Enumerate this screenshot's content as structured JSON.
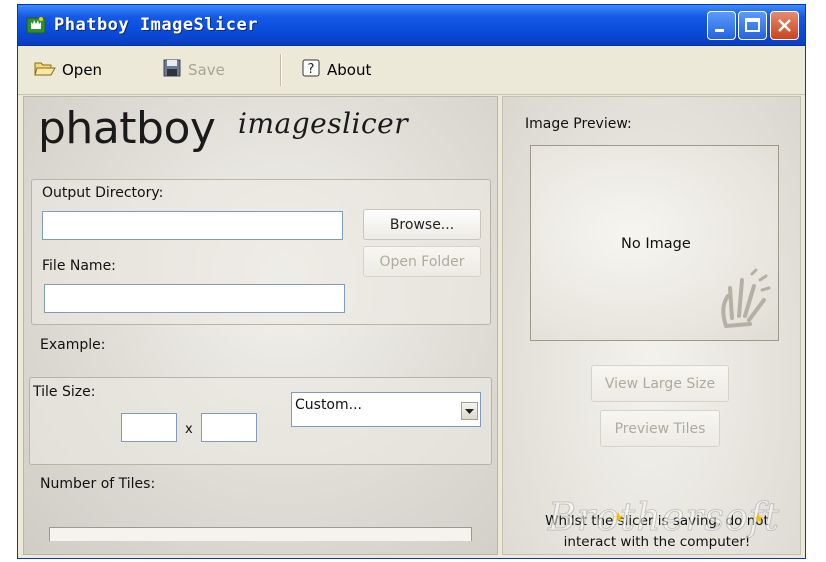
{
  "window": {
    "title": "Phatboy ImageSlicer"
  },
  "toolbar": {
    "open_label": "Open",
    "save_label": "Save",
    "about_label": "About"
  },
  "logo": {
    "main": "phatboy",
    "script": "imageslicer"
  },
  "output": {
    "dir_label": "Output Directory:",
    "dir_value": "",
    "browse_label": "Browse...",
    "open_folder_label": "Open Folder",
    "file_label": "File Name:",
    "file_value": ""
  },
  "example_label": "Example:",
  "tile": {
    "label": "Tile Size:",
    "width_value": "",
    "height_value": "",
    "x_symbol": "x",
    "preset_value": "Custom..."
  },
  "tiles_count_label": "Number of Tiles:",
  "preview": {
    "label": "Image Preview:",
    "empty_text": "No Image",
    "view_large_label": "View Large Size",
    "preview_tiles_label": "Preview Tiles",
    "warning_line1": "Whilst the slicer is saving, do not",
    "warning_line2": "interact with the computer!"
  },
  "watermark": "Brothersoft",
  "colors": {
    "title_bar": "#0a4ad8",
    "close_button": "#c9431f",
    "disabled_text": "#aeab9c"
  }
}
